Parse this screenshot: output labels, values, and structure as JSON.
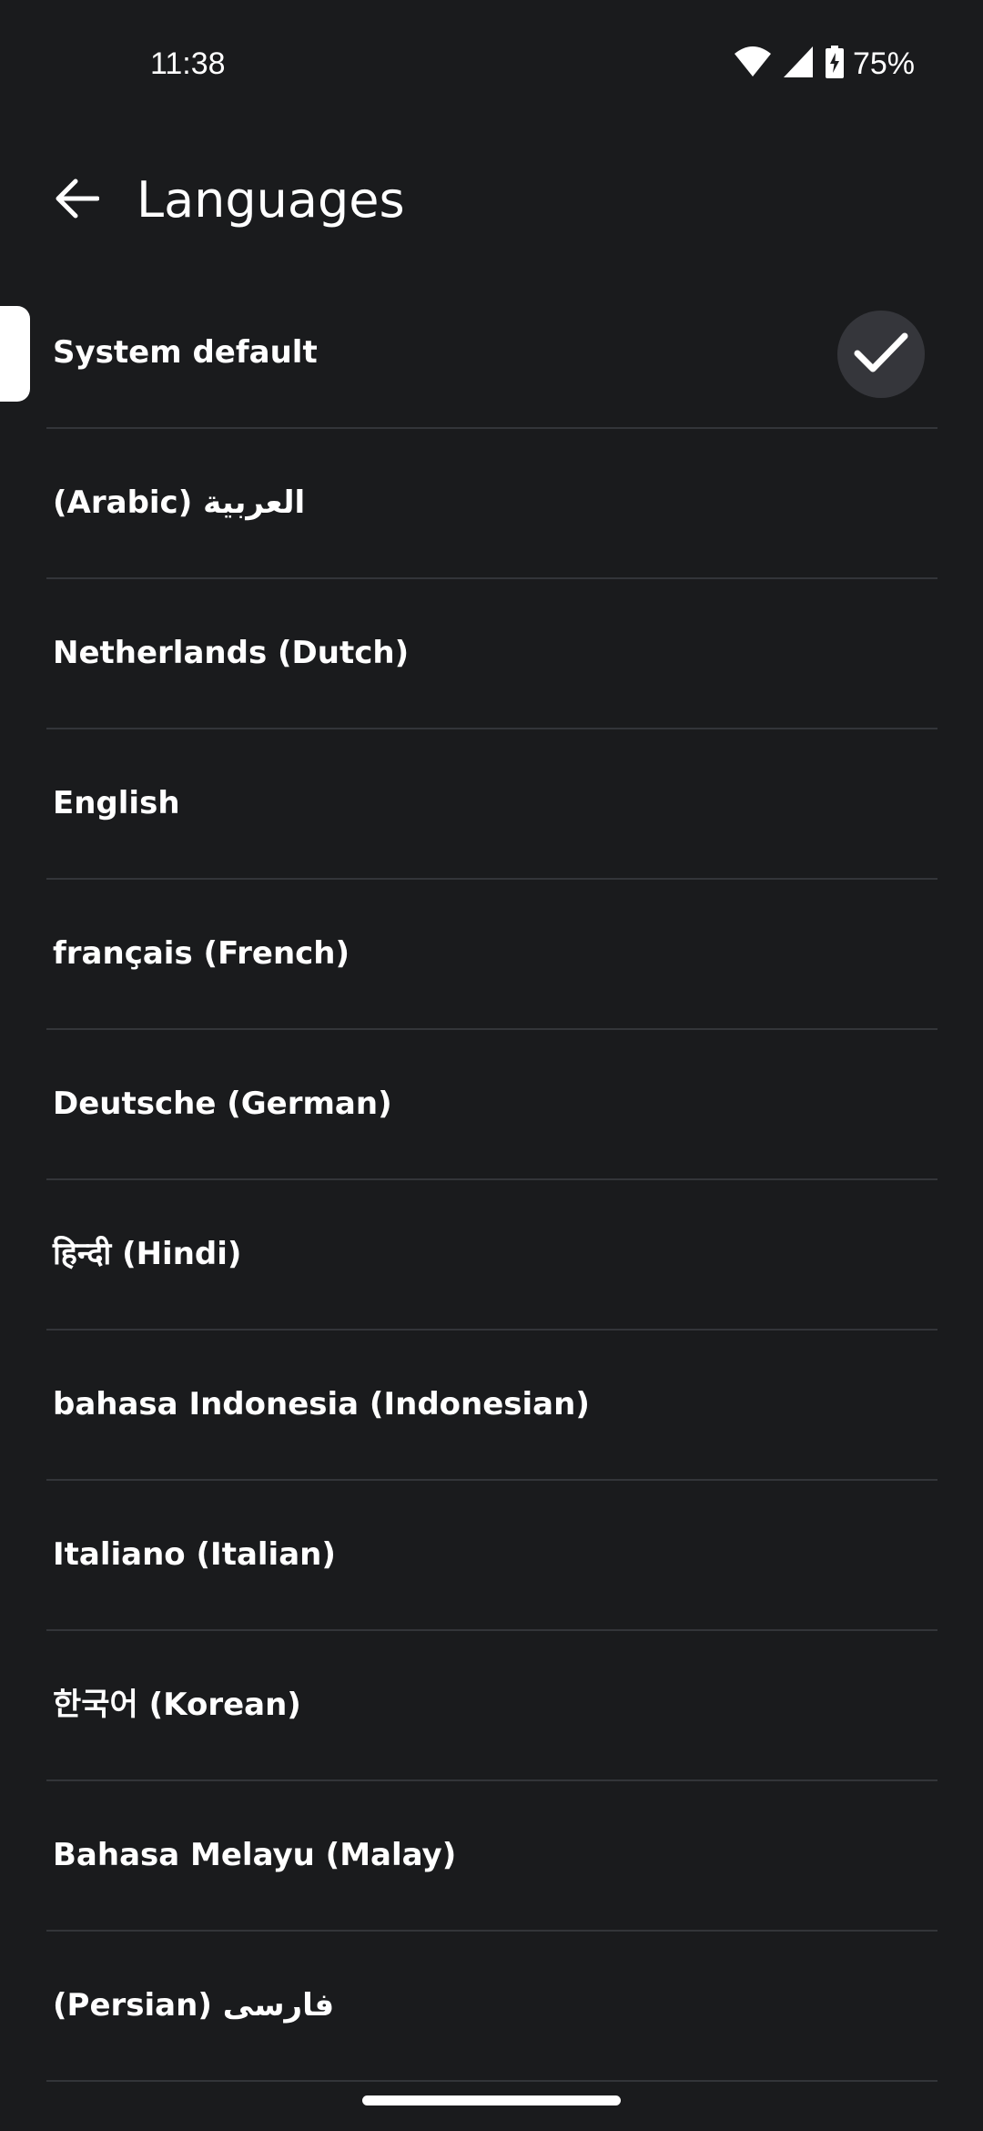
{
  "status_bar": {
    "time": "11:38",
    "battery_percent": "75%",
    "icons": [
      "wifi-icon",
      "signal-icon",
      "battery-charging-icon"
    ]
  },
  "app_bar": {
    "title": "Languages",
    "back_icon": "arrow-back-icon"
  },
  "languages": [
    {
      "label": "System default",
      "selected": true
    },
    {
      "label": "(Arabic) العربية",
      "selected": false
    },
    {
      "label": "Netherlands (Dutch)",
      "selected": false
    },
    {
      "label": "English",
      "selected": false
    },
    {
      "label": "français (French)",
      "selected": false
    },
    {
      "label": "Deutsche (German)",
      "selected": false
    },
    {
      "label": "हिन्दी (Hindi)",
      "selected": false
    },
    {
      "label": "bahasa Indonesia (Indonesian)",
      "selected": false
    },
    {
      "label": "Italiano (Italian)",
      "selected": false
    },
    {
      "label": "한국어 (Korean)",
      "selected": false
    },
    {
      "label": "Bahasa Melayu (Malay)",
      "selected": false
    },
    {
      "label": "(Persian) فارسى",
      "selected": false
    }
  ],
  "colors": {
    "background": "#1a1b1d",
    "divider": "#333539",
    "check_bubble": "#35363b",
    "text": "#ffffff"
  }
}
